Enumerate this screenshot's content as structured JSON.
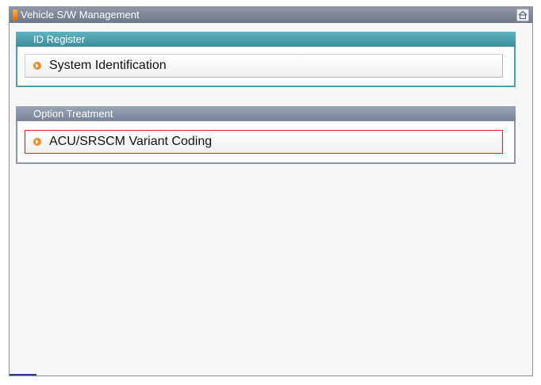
{
  "window": {
    "title": "Vehicle S/W Management",
    "home_icon": "home-icon"
  },
  "sections": [
    {
      "header": "ID Register",
      "items": [
        {
          "label": "System Identification",
          "icon": "arrow-bullet-icon"
        }
      ]
    },
    {
      "header": "Option Treatment",
      "items": [
        {
          "label": "ACU/SRSCM Variant Coding",
          "icon": "arrow-bullet-icon",
          "selected": true
        }
      ]
    }
  ],
  "colors": {
    "titlebar": "#7f8898",
    "section1_header": "#4aa2b0",
    "section2_header": "#8d97ab",
    "selection_border": "#e02020",
    "bullet": "#f08a1c"
  }
}
